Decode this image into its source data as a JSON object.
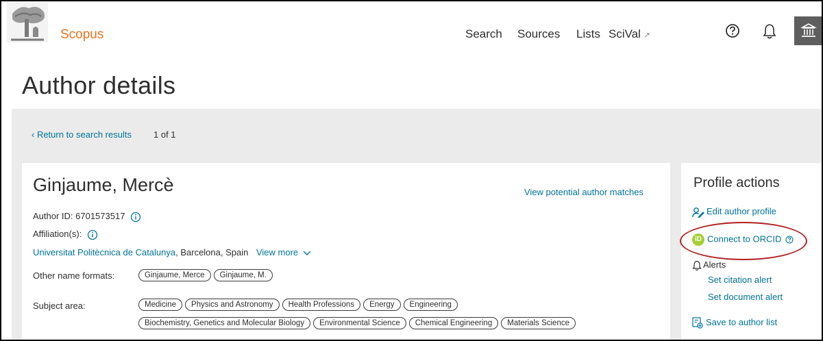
{
  "header": {
    "brand": "Scopus",
    "nav": {
      "search": "Search",
      "sources": "Sources",
      "lists": "Lists",
      "scival": "SciVal",
      "scival_ext": "↗"
    },
    "icons": [
      "elsevier-tree-logo",
      "help-icon",
      "bell-icon",
      "institution-icon"
    ]
  },
  "page": {
    "title": "Author details"
  },
  "results": {
    "return_label": "‹ Return to search results",
    "count": "1 of 1"
  },
  "author": {
    "name": "Ginjaume, Mercè",
    "matches_label": "View potential author matches",
    "id_label": "Author ID: 6701573517",
    "affiliation_label": "Affiliation(s):",
    "affiliation_name": "Universitat Politècnica de Catalunya",
    "affiliation_place": ", Barcelona, Spain",
    "view_more": "View more",
    "other_names_label": "Other name formats:",
    "other_names": [
      "Ginjaume, Merce",
      "Ginjaume, M."
    ],
    "subject_label": "Subject area:",
    "subjects_row1": [
      "Medicine",
      "Physics and Astronomy",
      "Health Professions",
      "Energy",
      "Engineering"
    ],
    "subjects_row2": [
      "Biochemistry, Genetics and Molecular Biology",
      "Environmental Science",
      "Chemical Engineering",
      "Materials Science"
    ]
  },
  "profile_actions": {
    "title": "Profile actions",
    "edit": "Edit author profile",
    "orcid": "Connect to ORCID",
    "orcid_badge": "iD",
    "alerts": "Alerts",
    "citation_alert": "Set citation alert",
    "document_alert": "Set document alert",
    "save": "Save to author list"
  },
  "colors": {
    "brand": "#e9711c",
    "link": "#007398",
    "orcid": "#a6ce39",
    "highlight": "#b21f1f"
  }
}
